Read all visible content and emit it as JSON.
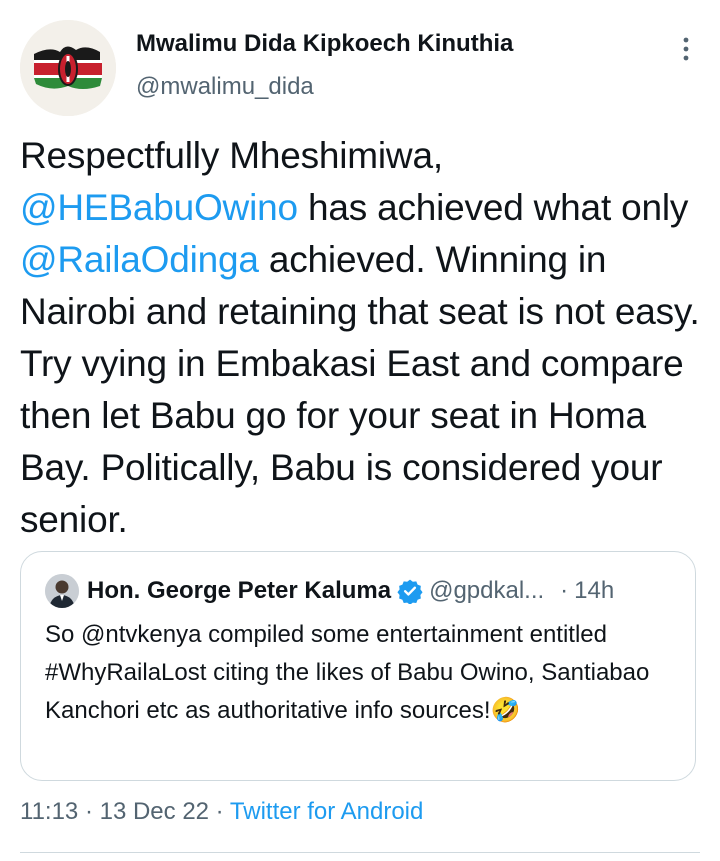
{
  "tweet": {
    "author_name": "Mwalimu Dida Kipkoech Kinuthia",
    "author_handle": "@mwalimu_dida",
    "more_icon": "more-vertical-icon",
    "text": {
      "p1": "Respectfully Mheshimiwa,",
      "mention1": "@HEBabuOwino",
      "p2": " has achieved what only ",
      "mention2": "@RailaOdinga",
      "p3": " achieved. Winning in Nairobi and retaining that seat is not easy. Try vying in Embakasi East and compare then let Babu go for your seat in Homa Bay. Politically, Babu is considered your senior."
    },
    "quoted": {
      "author_name": "Hon. George Peter Kaluma",
      "author_handle": "@gpdkal...",
      "separator": "·",
      "time": "14h",
      "verified_icon": "verified-badge-icon",
      "text": "So @ntvkenya compiled some entertainment entitled #WhyRailaLost citing the likes of Babu Owino, Santiabao Kanchori etc as authoritative info sources!",
      "emoji": "🤣"
    },
    "time": "11:13",
    "dot": " · ",
    "date": "13 Dec 22",
    "source": "Twitter for Android"
  },
  "colors": {
    "text": "#0f1419",
    "secondary": "#536471",
    "link": "#1d9bf0",
    "border": "#cfd9de",
    "verified": "#1d9bf0"
  }
}
